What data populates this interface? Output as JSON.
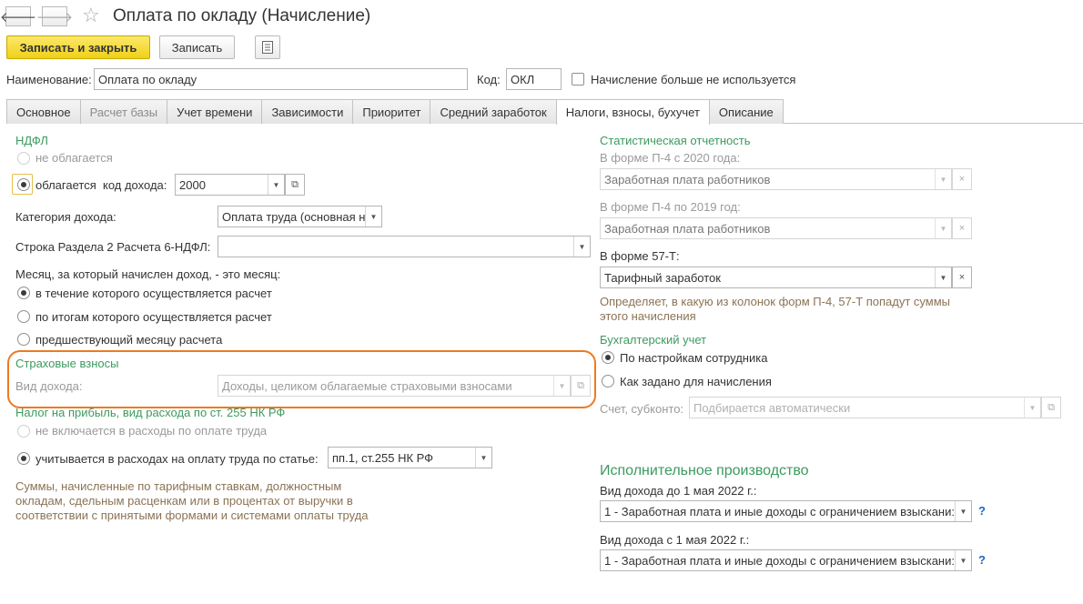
{
  "window": {
    "title": "Оплата по окладу (Начисление)",
    "back_icon": "arrow-left-icon",
    "forward_icon": "arrow-right-icon",
    "star_icon": "star-icon"
  },
  "toolbar": {
    "save_close": "Записать и закрыть",
    "save": "Записать",
    "doc_icon": "document-list-icon"
  },
  "header": {
    "name_label": "Наименование:",
    "name_value": "Оплата по окладу",
    "code_label": "Код:",
    "code_value": "ОКЛ",
    "unused_label": "Начисление больше не используется"
  },
  "tabs": [
    {
      "label": "Основное"
    },
    {
      "label": "Расчет базы"
    },
    {
      "label": "Учет времени"
    },
    {
      "label": "Зависимости"
    },
    {
      "label": "Приоритет"
    },
    {
      "label": "Средний заработок"
    },
    {
      "label": "Налоги, взносы, бухучет"
    },
    {
      "label": "Описание"
    }
  ],
  "ndfl": {
    "heading": "НДФЛ",
    "not_taxed": "не облагается",
    "taxed": "облагается",
    "income_code_label": "код дохода:",
    "income_code_value": "2000",
    "income_category_label": "Категория дохода:",
    "income_category_value": "Оплата труда (основная н",
    "row_6ndfl_label": "Строка Раздела 2 Расчета 6-НДФЛ:",
    "row_6ndfl_value": "",
    "month_question": "Месяц, за который начислен доход, - это месяц:",
    "month_opt1": "в течение которого осуществляется расчет",
    "month_opt2": "по итогам которого осуществляется расчет",
    "month_opt3": "предшествующий месяцу расчета"
  },
  "insurance": {
    "heading": "Страховые взносы",
    "income_type_label": "Вид дохода:",
    "income_type_value": "Доходы, целиком облагаемые страховыми взносами"
  },
  "profit_tax": {
    "heading": "Налог на прибыль, вид расхода по ст. 255 НК РФ",
    "opt_not_included": "не включается в расходы по оплате труда",
    "opt_included": "учитывается в расходах на оплату труда по статье:",
    "article_value": "пп.1, ст.255 НК РФ",
    "note": "Суммы, начисленные по тарифным ставкам, должностным окладам, сдельным расценкам или в процентах от выручки в соответствии с принятыми формами и системами оплаты труда",
    "note_lines": [
      "Суммы, начисленные по тарифным ставкам, должностным",
      "окладам, сдельным расценкам или в процентах от выручки в",
      "соответствии с принятыми формами и системами оплаты труда"
    ]
  },
  "stats": {
    "heading": "Статистическая отчетность",
    "p4_2020_label": "В форме П-4 с 2020 года:",
    "p4_2020_value": "Заработная плата работников",
    "p4_2019_label": "В форме П-4 по 2019 год:",
    "p4_2019_value": "Заработная плата работников",
    "f57_label": "В форме 57-Т:",
    "f57_value": "Тарифный заработок",
    "note_lines": [
      "Определяет, в какую из колонок форм П-4, 57-Т попадут суммы",
      "этого начисления"
    ]
  },
  "accounting": {
    "heading": "Бухгалтерский учет",
    "opt_employee": "По настройкам сотрудника",
    "opt_accrual": "Как задано для начисления",
    "account_label": "Счет, субконто:",
    "account_placeholder": "Подбирается автоматически"
  },
  "enforcement": {
    "heading": "Исполнительное производство",
    "before_label": "Вид дохода до 1 мая 2022 г.:",
    "before_value": "1 - Заработная плата и иные доходы с ограничением взыскани:",
    "after_label": "Вид дохода с 1 мая 2022 г.:",
    "after_value": "1 - Заработная плата и иные доходы с ограничением взыскани:",
    "help": "?"
  },
  "colors": {
    "accent_green": "#3c9a5f",
    "primary_button": "#f0d117",
    "highlight": "#ee7a22",
    "note_brown": "#8b7355"
  }
}
